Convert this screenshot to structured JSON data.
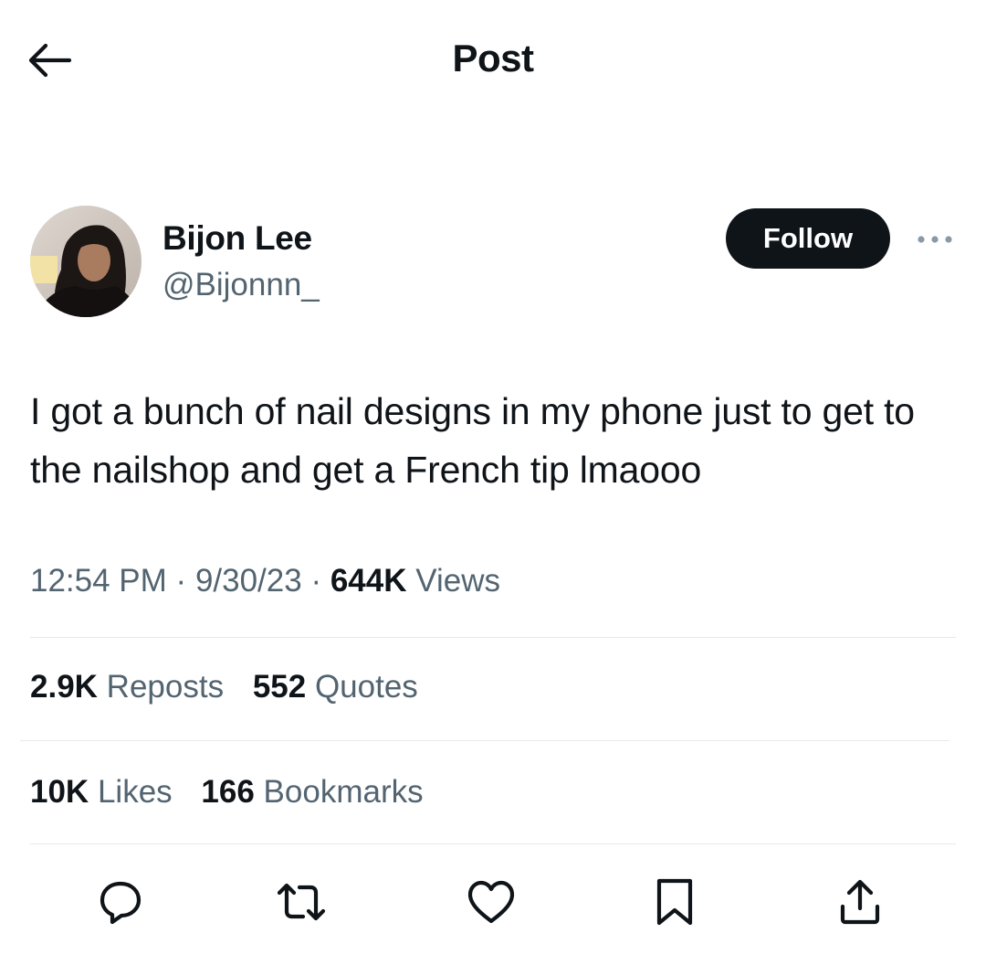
{
  "header": {
    "title": "Post",
    "back_icon": "arrow-left-icon"
  },
  "author": {
    "display_name": "Bijon Lee",
    "handle": "@Bijonnn_",
    "follow_label": "Follow",
    "more_icon": "more-horizontal-icon"
  },
  "tweet": {
    "text": "I got a bunch of nail designs in my phone just to get to the nailshop and get a French tip lmaooo",
    "time": "12:54 PM",
    "date": "9/30/23",
    "separator": "·",
    "views_count": "644K",
    "views_label": "Views"
  },
  "stats": {
    "reposts": {
      "count": "2.9K",
      "label": "Reposts"
    },
    "quotes": {
      "count": "552",
      "label": "Quotes"
    },
    "likes": {
      "count": "10K",
      "label": "Likes"
    },
    "bookmarks": {
      "count": "166",
      "label": "Bookmarks"
    }
  },
  "actions": [
    {
      "icon": "reply-icon"
    },
    {
      "icon": "repost-icon"
    },
    {
      "icon": "like-icon"
    },
    {
      "icon": "bookmark-icon"
    },
    {
      "icon": "share-icon"
    }
  ],
  "colors": {
    "text_primary": "#0f1419",
    "text_secondary": "#536471",
    "follow_bg": "#0f1419",
    "divider": "#e6e9ec"
  }
}
